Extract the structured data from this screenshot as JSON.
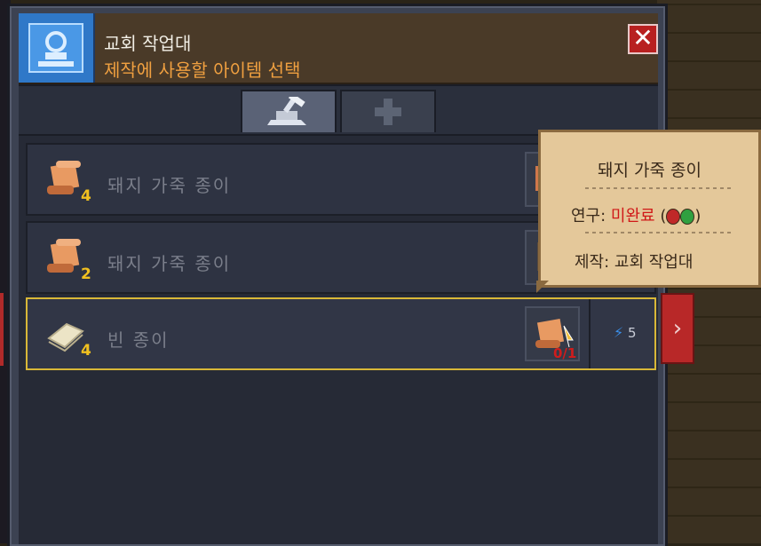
{
  "header": {
    "title": "교회 작업대",
    "subtitle": "제작에 사용할 아이템 선택",
    "close_label": "✕"
  },
  "tabs": [
    {
      "name": "crafting-tab",
      "icon": "hammer-anvil-icon",
      "active": true
    },
    {
      "name": "health-tab",
      "icon": "cross-icon",
      "active": false
    }
  ],
  "items": [
    {
      "name": "돼지 가죽 종이",
      "qty": "4",
      "icon": "scroll-icon",
      "selected": false
    },
    {
      "name": "돼지 가죽 종이",
      "qty": "2",
      "icon": "scroll-icon",
      "selected": false
    },
    {
      "name": "빈 종이",
      "qty": "4",
      "icon": "blank-paper-icon",
      "selected": true,
      "slot_count": "0/1",
      "energy": "5"
    }
  ],
  "tooltip": {
    "title": "돼지 가죽 종이",
    "research_label": "연구:",
    "research_status": "미완료",
    "craft_text": "제작: 교회 작업대"
  },
  "colors": {
    "accent_gold": "#d8b838",
    "title_orange": "#f0a040",
    "status_red": "#d01818",
    "header_blue": "#2f78c8"
  }
}
